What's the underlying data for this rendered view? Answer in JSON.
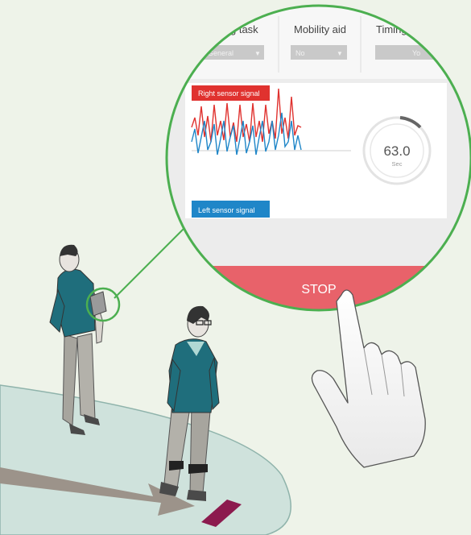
{
  "app": {
    "task_header": "g task",
    "task_value": "General",
    "mobility_header": "Mobility aid",
    "mobility_value": "No",
    "timing_header": "Timing",
    "timing_value": "Yo",
    "right_signal_label": "Right sensor signal",
    "left_signal_label": "Left sensor signal",
    "timer_value": "63.0",
    "timer_unit": "Sec",
    "stop_label": "STOP"
  },
  "colors": {
    "right_signal": "#e0322f",
    "left_signal": "#1f86c8",
    "stop_button": "#e8626a",
    "magnifier_ring": "#4caf50",
    "floor": "#cfe2dc",
    "start_mark": "#8c1a4e"
  }
}
